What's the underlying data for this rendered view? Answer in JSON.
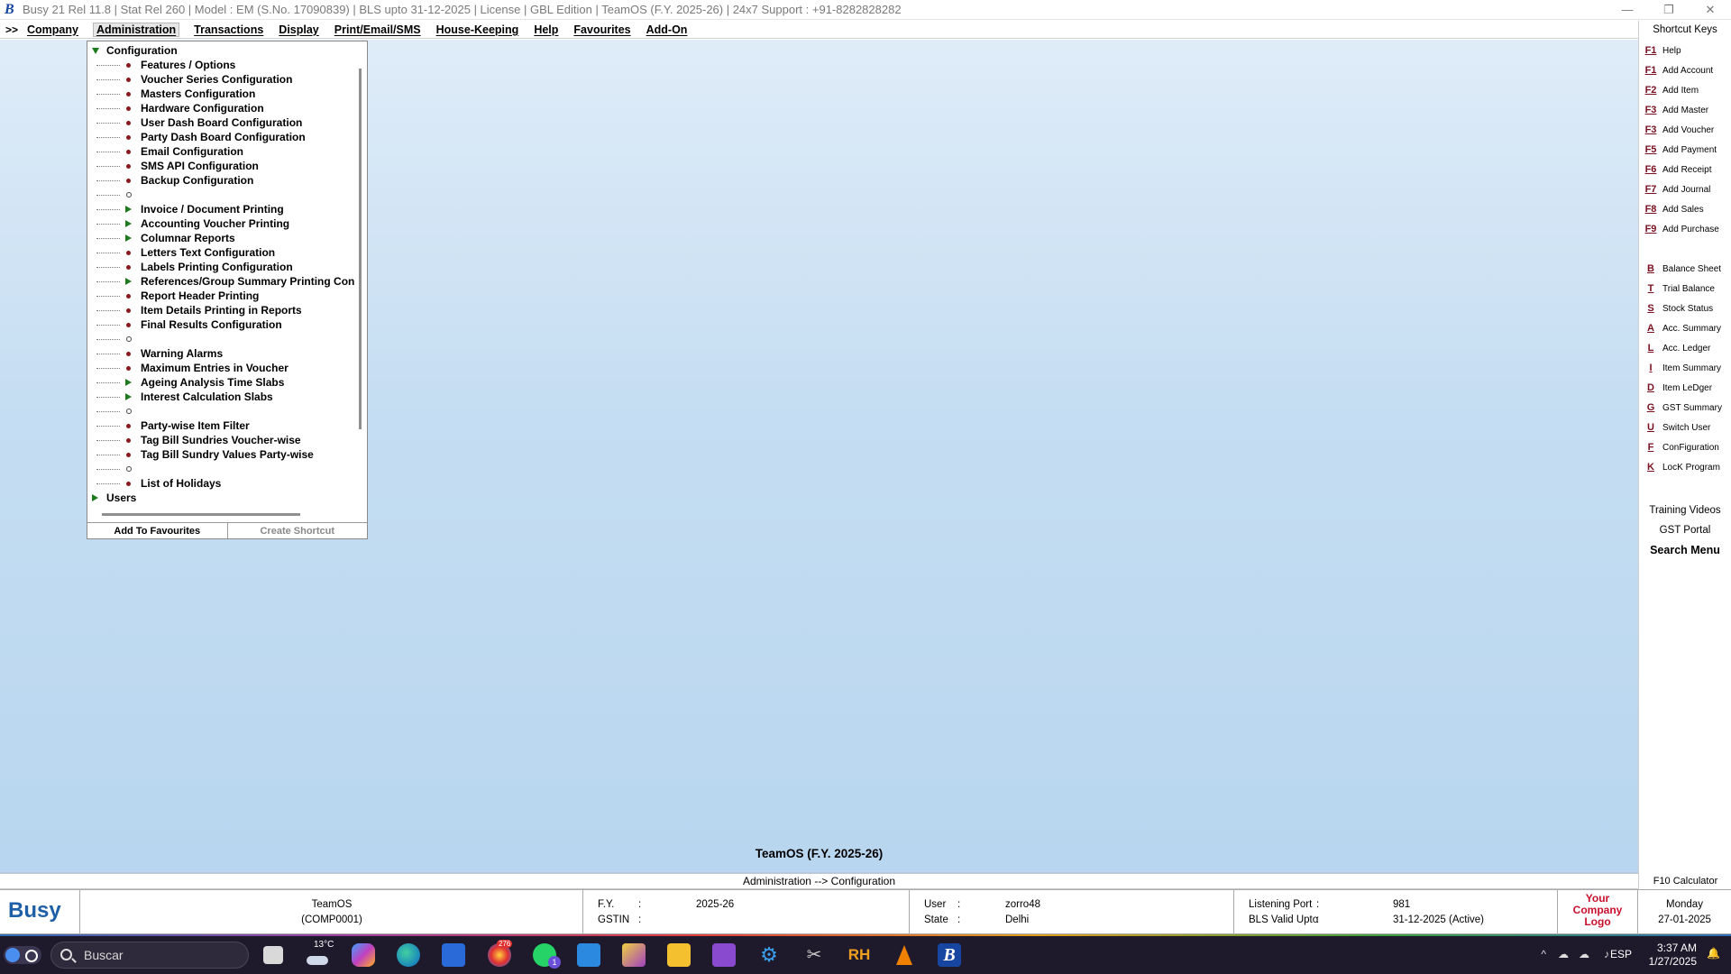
{
  "titlebar": {
    "logo": "B",
    "text": "Busy 21  Rel 11.8  |  Stat Rel 260  |  Model : EM (S.No. 17090839)  |  BLS upto 31-12-2025  |  License  |  GBL Edition  |  TeamOS (F.Y. 2025-26)  |  24x7 Support : +91-8282828282"
  },
  "menubar": {
    "chevron": ">>",
    "items": [
      "Company",
      "Administration",
      "Transactions",
      "Display",
      "Print/Email/SMS",
      "House-Keeping",
      "Help",
      "Favourites",
      "Add-On"
    ]
  },
  "tree": {
    "root": "Configuration",
    "items": [
      {
        "label": "Features / Options",
        "type": "bullet"
      },
      {
        "label": "Voucher Series Configuration",
        "type": "bullet"
      },
      {
        "label": "Masters Configuration",
        "type": "bullet"
      },
      {
        "label": "Hardware Configuration",
        "type": "bullet"
      },
      {
        "label": "User Dash Board Configuration",
        "type": "bullet"
      },
      {
        "label": "Party Dash Board Configuration",
        "type": "bullet"
      },
      {
        "label": "Email Configuration",
        "type": "bullet"
      },
      {
        "label": "SMS API Configuration",
        "type": "bullet"
      },
      {
        "label": "Backup Configuration",
        "type": "bullet"
      },
      {
        "label": "",
        "type": "circle"
      },
      {
        "label": "Invoice / Document Printing",
        "type": "triangle"
      },
      {
        "label": "Accounting Voucher Printing",
        "type": "triangle"
      },
      {
        "label": "Columnar Reports",
        "type": "triangle"
      },
      {
        "label": "Letters Text Configuration",
        "type": "bullet"
      },
      {
        "label": "Labels Printing Configuration",
        "type": "bullet"
      },
      {
        "label": "References/Group Summary Printing Conf",
        "type": "triangle"
      },
      {
        "label": "Report Header Printing",
        "type": "bullet"
      },
      {
        "label": "Item Details Printing in Reports",
        "type": "bullet"
      },
      {
        "label": "Final Results Configuration",
        "type": "bullet"
      },
      {
        "label": "",
        "type": "circle"
      },
      {
        "label": "Warning Alarms",
        "type": "bullet"
      },
      {
        "label": "Maximum Entries in Voucher",
        "type": "bullet"
      },
      {
        "label": "Ageing Analysis Time Slabs",
        "type": "triangle"
      },
      {
        "label": "Interest Calculation Slabs",
        "type": "triangle"
      },
      {
        "label": "",
        "type": "circle"
      },
      {
        "label": "Party-wise Item Filter",
        "type": "bullet"
      },
      {
        "label": "Tag Bill Sundries Voucher-wise",
        "type": "bullet"
      },
      {
        "label": "Tag Bill Sundry Values Party-wise",
        "type": "bullet"
      },
      {
        "label": "",
        "type": "circle"
      },
      {
        "label": "List of Holidays",
        "type": "bullet"
      }
    ],
    "users": "Users"
  },
  "panel_buttons": {
    "add_fav": "Add To Favourites",
    "create_shortcut": "Create Shortcut"
  },
  "shortcuts": {
    "header": "Shortcut Keys",
    "group1": [
      {
        "key": "F1",
        "label": "Help"
      },
      {
        "key": "F1",
        "label": "Add Account"
      },
      {
        "key": "F2",
        "label": "Add Item"
      },
      {
        "key": "F3",
        "label": "Add Master"
      },
      {
        "key": "F3",
        "label": "Add Voucher"
      },
      {
        "key": "F5",
        "label": "Add Payment"
      },
      {
        "key": "F6",
        "label": "Add Receipt"
      },
      {
        "key": "F7",
        "label": "Add Journal"
      },
      {
        "key": "F8",
        "label": "Add Sales"
      },
      {
        "key": "F9",
        "label": "Add Purchase"
      }
    ],
    "group2": [
      {
        "key": "B",
        "label": "Balance Sheet"
      },
      {
        "key": "T",
        "label": "Trial Balance"
      },
      {
        "key": "S",
        "label": "Stock Status"
      },
      {
        "key": "A",
        "label": "Acc. Summary"
      },
      {
        "key": "L",
        "label": "Acc. Ledger"
      },
      {
        "key": "I",
        "label": "Item Summary"
      },
      {
        "key": "D",
        "label": "Item LeDger"
      },
      {
        "key": "G",
        "label": "GST Summary"
      },
      {
        "key": "U",
        "label": "Switch User"
      },
      {
        "key": "F",
        "label": "ConFiguration"
      },
      {
        "key": "K",
        "label": "LocK Program"
      }
    ],
    "training": "Training Videos",
    "gst_portal": "GST Portal",
    "search_menu": "Search Menu",
    "calculator": "F10 Calculator"
  },
  "main": {
    "company_title": "TeamOS (F.Y. 2025-26)",
    "breadcrumb": "Administration --> Configuration"
  },
  "status": {
    "brand": "Busy",
    "company_name": "TeamOS",
    "company_code": "(COMP0001)",
    "fy_label": "F.Y.",
    "fy_value": "2025-26",
    "gstin_label": "GSTIN",
    "gstin_value": "",
    "user_label": "User",
    "user_value": "zorro48",
    "state_label": "State",
    "state_value": "Delhi",
    "port_label": "Listening Port",
    "port_value": "981",
    "bls_label": "BLS Valid Upto",
    "bls_value": "31-12-2025 (Active)",
    "logo_l1": "Your",
    "logo_l2": "Company",
    "logo_l3": "Logo",
    "day": "Monday",
    "date": "27-01-2025",
    "colon": ":"
  },
  "taskbar": {
    "search_placeholder": "Buscar",
    "weather": "13°C",
    "lang": "ESP",
    "time": "3:37 AM",
    "date": "1/27/2025",
    "badge1": "276",
    "badge2": "1"
  },
  "colors": {
    "accent": "#1f5fa8",
    "key_color": "#7a1020",
    "logo_red": "#c8102e"
  }
}
